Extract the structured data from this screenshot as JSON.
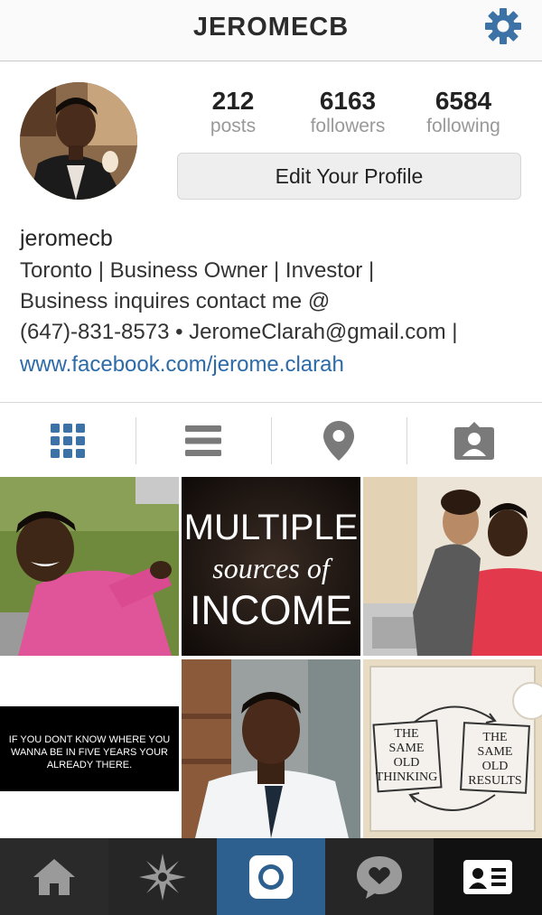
{
  "header": {
    "title": "JEROMECB",
    "settings_icon": "gear-icon",
    "accent": "#3c72a6"
  },
  "stats": [
    {
      "value": "212",
      "label": "posts"
    },
    {
      "value": "6163",
      "label": "followers"
    },
    {
      "value": "6584",
      "label": "following"
    }
  ],
  "profile": {
    "edit_label": "Edit Your Profile",
    "username": "jeromecb",
    "bio_lines": [
      "Toronto | Business Owner | Investor |",
      "Business inquires contact me @",
      "(647)-831-8573 • JeromeClarah@gmail.com |"
    ],
    "link": "www.facebook.com/jerome.clarah",
    "link_color": "#2c6aa8"
  },
  "view_tabs": [
    {
      "icon": "grid-icon",
      "active": true
    },
    {
      "icon": "list-icon",
      "active": false
    },
    {
      "icon": "location-pin-icon",
      "active": false
    },
    {
      "icon": "tagged-person-icon",
      "active": false
    }
  ],
  "posts": [
    {
      "kind": "photo",
      "subject": "selfie-pink-shirt"
    },
    {
      "kind": "text",
      "lines": [
        "MULTIPLE",
        "sources of",
        "INCOME"
      ]
    },
    {
      "kind": "photo",
      "subject": "couple-selfie"
    },
    {
      "kind": "text",
      "text": "IF YOU DONT KNOW WHERE YOU WANNA BE IN FIVE YEARS YOUR ALREADY THERE."
    },
    {
      "kind": "photo",
      "subject": "selfie-white-shirt-tie"
    },
    {
      "kind": "sketch",
      "left": [
        "THE",
        "SAME",
        "OLD",
        "THINKING"
      ],
      "right": [
        "THE",
        "SAME",
        "OLD",
        "RESULTS"
      ]
    }
  ],
  "bottom_nav": [
    {
      "icon": "home-icon",
      "active": false
    },
    {
      "icon": "explore-icon",
      "active": false
    },
    {
      "icon": "camera-icon",
      "active": true
    },
    {
      "icon": "activity-icon",
      "active": false
    },
    {
      "icon": "profile-icon",
      "active": false
    }
  ]
}
